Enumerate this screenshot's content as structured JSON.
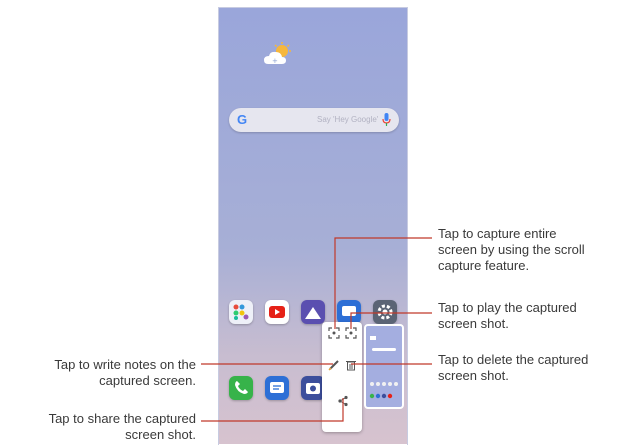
{
  "search": {
    "placeholder": "Say 'Hey Google'"
  },
  "callouts": {
    "scroll_capture": "Tap to capture entire screen by using the scroll capture feature.",
    "scroll_lines": [
      "Tap to capture entire",
      "screen by using the scroll",
      "capture feature."
    ],
    "play": [
      "Tap to play the captured",
      "screen shot."
    ],
    "write": [
      "Tap to write notes on the",
      "captured screen."
    ],
    "delete": [
      "Tap to delete the captured",
      "screen shot."
    ],
    "share": [
      "Tap to share the captured",
      "screen shot."
    ]
  },
  "colors": {
    "callout_line": "#c0392b",
    "wallpaper_top": "#9aa6da",
    "wallpaper_bottom": "#d7c3cf"
  },
  "icons": [
    "weather-icon",
    "google-icon",
    "mic-icon",
    "apps-folder-icon",
    "youtube-icon",
    "gallery-icon",
    "messages-icon",
    "settings-icon",
    "phone-icon",
    "chat-icon",
    "camera-icon",
    "scroll-capture-icon",
    "play-capture-icon",
    "pen-icon",
    "trash-icon",
    "share-icon"
  ]
}
